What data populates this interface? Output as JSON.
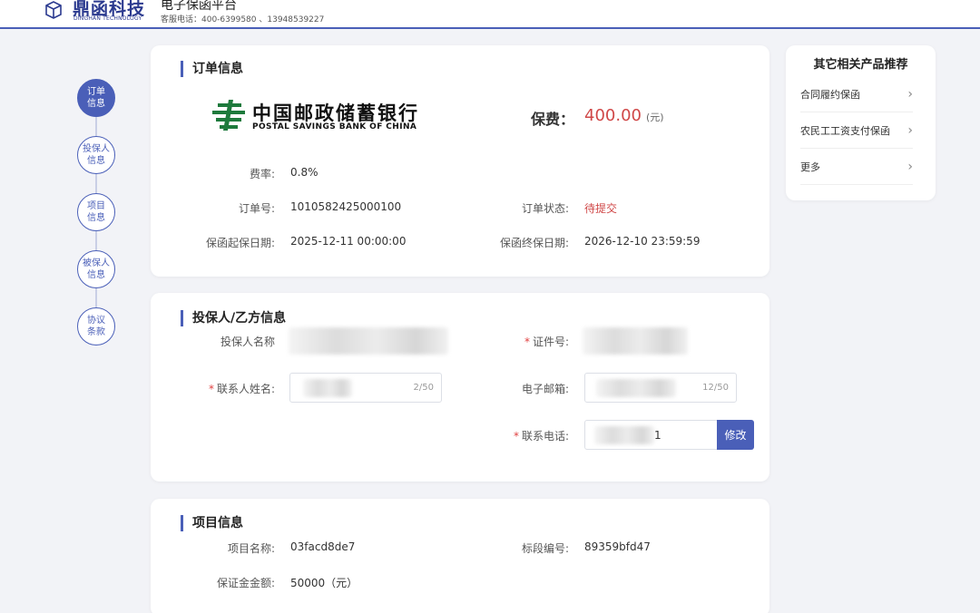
{
  "header": {
    "logo_text": "鼎函科技",
    "logo_sub": "DINGHAN TECHNOLOGY",
    "platform_title": "电子保函平台",
    "hotline": "客服电话：400-6399580 、13948539227"
  },
  "steps": [
    {
      "label": "订单\n信息",
      "active": true
    },
    {
      "label": "投保人\n信息",
      "active": false
    },
    {
      "label": "项目\n信息",
      "active": false
    },
    {
      "label": "被保人\n信息",
      "active": false
    },
    {
      "label": "协议\n条款",
      "active": false
    }
  ],
  "order": {
    "title": "订单信息",
    "bank_name_cn": "中国邮政储蓄银行",
    "bank_name_en": "POSTAL SAVINGS BANK OF CHINA",
    "fee_label": "保费：",
    "fee_value": "400.00",
    "fee_unit": "(元)",
    "rate_label": "费率:",
    "rate_value": "0.8%",
    "order_no_label": "订单号:",
    "order_no_value": "1010582425000100",
    "status_label": "订单状态:",
    "status_value": "待提交",
    "start_label": "保函起保日期:",
    "start_value": "2025-12-11 00:00:00",
    "end_label": "保函终保日期:",
    "end_value": "2026-12-10 23:59:59"
  },
  "applicant": {
    "title": "投保人/乙方信息",
    "name_label": "投保人名称",
    "id_label": "证件号:",
    "contact_label": "联系人姓名:",
    "contact_counter": "2/50",
    "email_label": "电子邮箱:",
    "email_counter": "12/50",
    "phone_label": "联系电话:",
    "phone_suffix": "1",
    "edit_button": "修改"
  },
  "project": {
    "title": "项目信息",
    "name_label": "项目名称:",
    "name_value": "03facd8de7",
    "section_label": "标段编号:",
    "section_value": "89359bfd47",
    "amount_label": "保证金金额:",
    "amount_value": "50000（元）"
  },
  "sidebar": {
    "title": "其它相关产品推荐",
    "items": [
      {
        "label": "合同履约保函"
      },
      {
        "label": "农民工工资支付保函"
      },
      {
        "label": "更多"
      }
    ]
  },
  "colors": {
    "accent": "#4a5fb8",
    "status_red": "#d04848",
    "bank_green": "#1e7a3c"
  }
}
